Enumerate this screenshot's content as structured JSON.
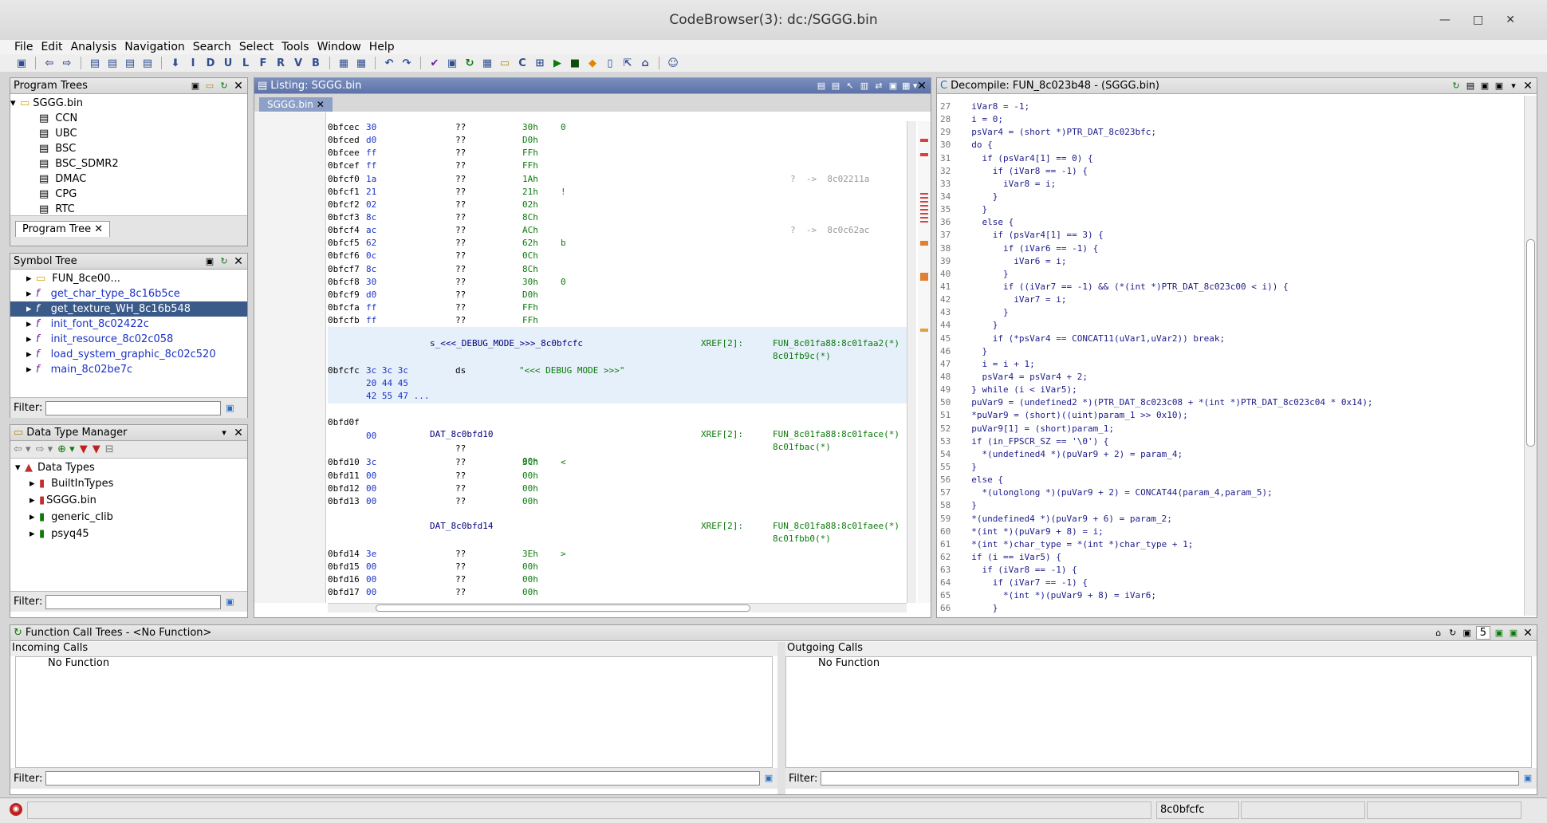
{
  "window": {
    "title": "CodeBrowser(3): dc:/SGGG.bin"
  },
  "menu": [
    "File",
    "Edit",
    "Analysis",
    "Navigation",
    "Search",
    "Select",
    "Tools",
    "Window",
    "Help"
  ],
  "program_trees": {
    "title": "Program Trees",
    "root": "SGGG.bin",
    "items": [
      "CCN",
      "UBC",
      "BSC",
      "BSC_SDMR2",
      "DMAC",
      "CPG",
      "RTC"
    ],
    "tab": "Program Tree"
  },
  "symbol_tree": {
    "title": "Symbol Tree",
    "items": [
      "FUN_8ce00...",
      "get_char_type_8c16b5ce",
      "get_texture_WH_8c16b548",
      "init_font_8c02422c",
      "init_resource_8c02c058",
      "load_system_graphic_8c02c520",
      "main_8c02be7c"
    ],
    "filter_label": "Filter:"
  },
  "data_type_manager": {
    "title": "Data Type Manager",
    "root": "Data Types",
    "items": [
      "BuiltInTypes",
      "SGGG.bin",
      "generic_clib",
      "psyq45"
    ],
    "filter_label": "Filter:"
  },
  "listing": {
    "title": "Listing:  SGGG.bin",
    "tab": "SGGG.bin",
    "rows": [
      {
        "addr": "0bfcec",
        "bytes": "30",
        "op": "??",
        "val": "30h",
        "ch": "0",
        "ref": ""
      },
      {
        "addr": "0bfced",
        "bytes": "d0",
        "op": "??",
        "val": "D0h",
        "ch": "",
        "ref": ""
      },
      {
        "addr": "0bfcee",
        "bytes": "ff",
        "op": "??",
        "val": "FFh",
        "ch": "",
        "ref": ""
      },
      {
        "addr": "0bfcef",
        "bytes": "ff",
        "op": "??",
        "val": "FFh",
        "ch": "",
        "ref": ""
      },
      {
        "addr": "0bfcf0",
        "bytes": "1a",
        "op": "??",
        "val": "1Ah",
        "ch": "",
        "ref": "?  ->  8c02211a"
      },
      {
        "addr": "0bfcf1",
        "bytes": "21",
        "op": "??",
        "val": "21h",
        "ch": "!",
        "ref": ""
      },
      {
        "addr": "0bfcf2",
        "bytes": "02",
        "op": "??",
        "val": "02h",
        "ch": "",
        "ref": ""
      },
      {
        "addr": "0bfcf3",
        "bytes": "8c",
        "op": "??",
        "val": "8Ch",
        "ch": "",
        "ref": ""
      },
      {
        "addr": "0bfcf4",
        "bytes": "ac",
        "op": "??",
        "val": "ACh",
        "ch": "",
        "ref": "?  ->  8c0c62ac"
      },
      {
        "addr": "0bfcf5",
        "bytes": "62",
        "op": "??",
        "val": "62h",
        "ch": "b",
        "ref": ""
      },
      {
        "addr": "0bfcf6",
        "bytes": "0c",
        "op": "??",
        "val": "0Ch",
        "ch": "",
        "ref": ""
      },
      {
        "addr": "0bfcf7",
        "bytes": "8c",
        "op": "??",
        "val": "8Ch",
        "ch": "",
        "ref": ""
      },
      {
        "addr": "0bfcf8",
        "bytes": "30",
        "op": "??",
        "val": "30h",
        "ch": "0",
        "ref": ""
      },
      {
        "addr": "0bfcf9",
        "bytes": "d0",
        "op": "??",
        "val": "D0h",
        "ch": "",
        "ref": ""
      },
      {
        "addr": "0bfcfa",
        "bytes": "ff",
        "op": "??",
        "val": "FFh",
        "ch": "",
        "ref": ""
      },
      {
        "addr": "0bfcfb",
        "bytes": "ff",
        "op": "??",
        "val": "FFh",
        "ch": "",
        "ref": ""
      }
    ],
    "debug_label": "s_<<<_DEBUG_MODE_>>>_8c0bfcfc",
    "debug_xref": "XREF[2]:",
    "debug_xref_targets": [
      "FUN_8c01fa88:8c01faa2(*)",
      "8c01fb9c(*)"
    ],
    "debug_addr": "0bfcfc",
    "debug_bytes": [
      "3c 3c 3c",
      "20 44 45",
      "42 55 47 ..."
    ],
    "debug_op": "ds",
    "debug_str": "\"<<< DEBUG MODE >>>\"",
    "row_d0f": {
      "addr": "0bfd0f",
      "bytes": "00",
      "op": "??",
      "val": "00h"
    },
    "dat1_label": "DAT_8c0bfd10",
    "dat1_xref": "XREF[2]:",
    "dat1_targets": [
      "FUN_8c01fa88:8c01face(*)",
      "8c01fbac(*)"
    ],
    "dat1_rows": [
      {
        "addr": "0bfd10",
        "bytes": "3c",
        "op": "??",
        "val": "3Ch",
        "ch": "<"
      },
      {
        "addr": "0bfd11",
        "bytes": "00",
        "op": "??",
        "val": "00h",
        "ch": ""
      },
      {
        "addr": "0bfd12",
        "bytes": "00",
        "op": "??",
        "val": "00h",
        "ch": ""
      },
      {
        "addr": "0bfd13",
        "bytes": "00",
        "op": "??",
        "val": "00h",
        "ch": ""
      }
    ],
    "dat2_label": "DAT_8c0bfd14",
    "dat2_xref": "XREF[2]:",
    "dat2_targets": [
      "FUN_8c01fa88:8c01faee(*)",
      "8c01fbb0(*)"
    ],
    "dat2_rows": [
      {
        "addr": "0bfd14",
        "bytes": "3e",
        "op": "??",
        "val": "3Eh",
        "ch": ">"
      },
      {
        "addr": "0bfd15",
        "bytes": "00",
        "op": "??",
        "val": "00h",
        "ch": ""
      },
      {
        "addr": "0bfd16",
        "bytes": "00",
        "op": "??",
        "val": "00h",
        "ch": ""
      },
      {
        "addr": "0bfd17",
        "bytes": "00",
        "op": "??",
        "val": "00h",
        "ch": ""
      }
    ]
  },
  "decompile": {
    "title": "Decompile: FUN_8c023b48 -  (SGGG.bin)",
    "lines": [
      {
        "n": "27",
        "t": "  iVar8 = -1;"
      },
      {
        "n": "28",
        "t": "  i = 0;"
      },
      {
        "n": "29",
        "t": "  psVar4 = (short *)PTR_DAT_8c023bfc;"
      },
      {
        "n": "30",
        "t": "  do {"
      },
      {
        "n": "31",
        "t": "    if (psVar4[1] == 0) {"
      },
      {
        "n": "32",
        "t": "      if (iVar8 == -1) {"
      },
      {
        "n": "33",
        "t": "        iVar8 = i;"
      },
      {
        "n": "34",
        "t": "      }"
      },
      {
        "n": "35",
        "t": "    }"
      },
      {
        "n": "36",
        "t": "    else {"
      },
      {
        "n": "37",
        "t": "      if (psVar4[1] == 3) {"
      },
      {
        "n": "38",
        "t": "        if (iVar6 == -1) {"
      },
      {
        "n": "39",
        "t": "          iVar6 = i;"
      },
      {
        "n": "40",
        "t": "        }"
      },
      {
        "n": "41",
        "t": "        if ((iVar7 == -1) && (*(int *)PTR_DAT_8c023c00 < i)) {"
      },
      {
        "n": "42",
        "t": "          iVar7 = i;"
      },
      {
        "n": "43",
        "t": "        }"
      },
      {
        "n": "44",
        "t": "      }"
      },
      {
        "n": "45",
        "t": "      if (*psVar4 == CONCAT11(uVar1,uVar2)) break;"
      },
      {
        "n": "46",
        "t": "    }"
      },
      {
        "n": "47",
        "t": "    i = i + 1;"
      },
      {
        "n": "48",
        "t": "    psVar4 = psVar4 + 2;"
      },
      {
        "n": "49",
        "t": "  } while (i < iVar5);"
      },
      {
        "n": "50",
        "t": "  puVar9 = (undefined2 *)(PTR_DAT_8c023c08 + *(int *)PTR_DAT_8c023c04 * 0x14);"
      },
      {
        "n": "51",
        "t": "  *puVar9 = (short)((uint)param_1 >> 0x10);"
      },
      {
        "n": "52",
        "t": "  puVar9[1] = (short)param_1;"
      },
      {
        "n": "53",
        "t": "  if (in_FPSCR_SZ == '\\0') {"
      },
      {
        "n": "54",
        "t": "    *(undefined4 *)(puVar9 + 2) = param_4;"
      },
      {
        "n": "55",
        "t": "  }"
      },
      {
        "n": "56",
        "t": "  else {"
      },
      {
        "n": "57",
        "t": "    *(ulonglong *)(puVar9 + 2) = CONCAT44(param_4,param_5);"
      },
      {
        "n": "58",
        "t": "  }"
      },
      {
        "n": "59",
        "t": "  *(undefined4 *)(puVar9 + 6) = param_2;"
      },
      {
        "n": "60",
        "t": "  *(int *)(puVar9 + 8) = i;"
      },
      {
        "n": "61",
        "t": "  *(int *)char_type = *(int *)char_type + 1;"
      },
      {
        "n": "62",
        "t": "  if (i == iVar5) {"
      },
      {
        "n": "63",
        "t": "    if (iVar8 == -1) {"
      },
      {
        "n": "64",
        "t": "      if (iVar7 == -1) {"
      },
      {
        "n": "65",
        "t": "        *(int *)(puVar9 + 8) = iVar6;"
      },
      {
        "n": "66",
        "t": "      }"
      }
    ]
  },
  "function_call_trees": {
    "title": "Function Call Trees - <No Function>",
    "incoming_label": "Incoming Calls",
    "incoming_item": "No Function",
    "outgoing_label": "Outgoing Calls",
    "outgoing_item": "No Function",
    "filter_label": "Filter:",
    "depth": "5"
  },
  "status": {
    "address": "8c0bfcfc"
  }
}
